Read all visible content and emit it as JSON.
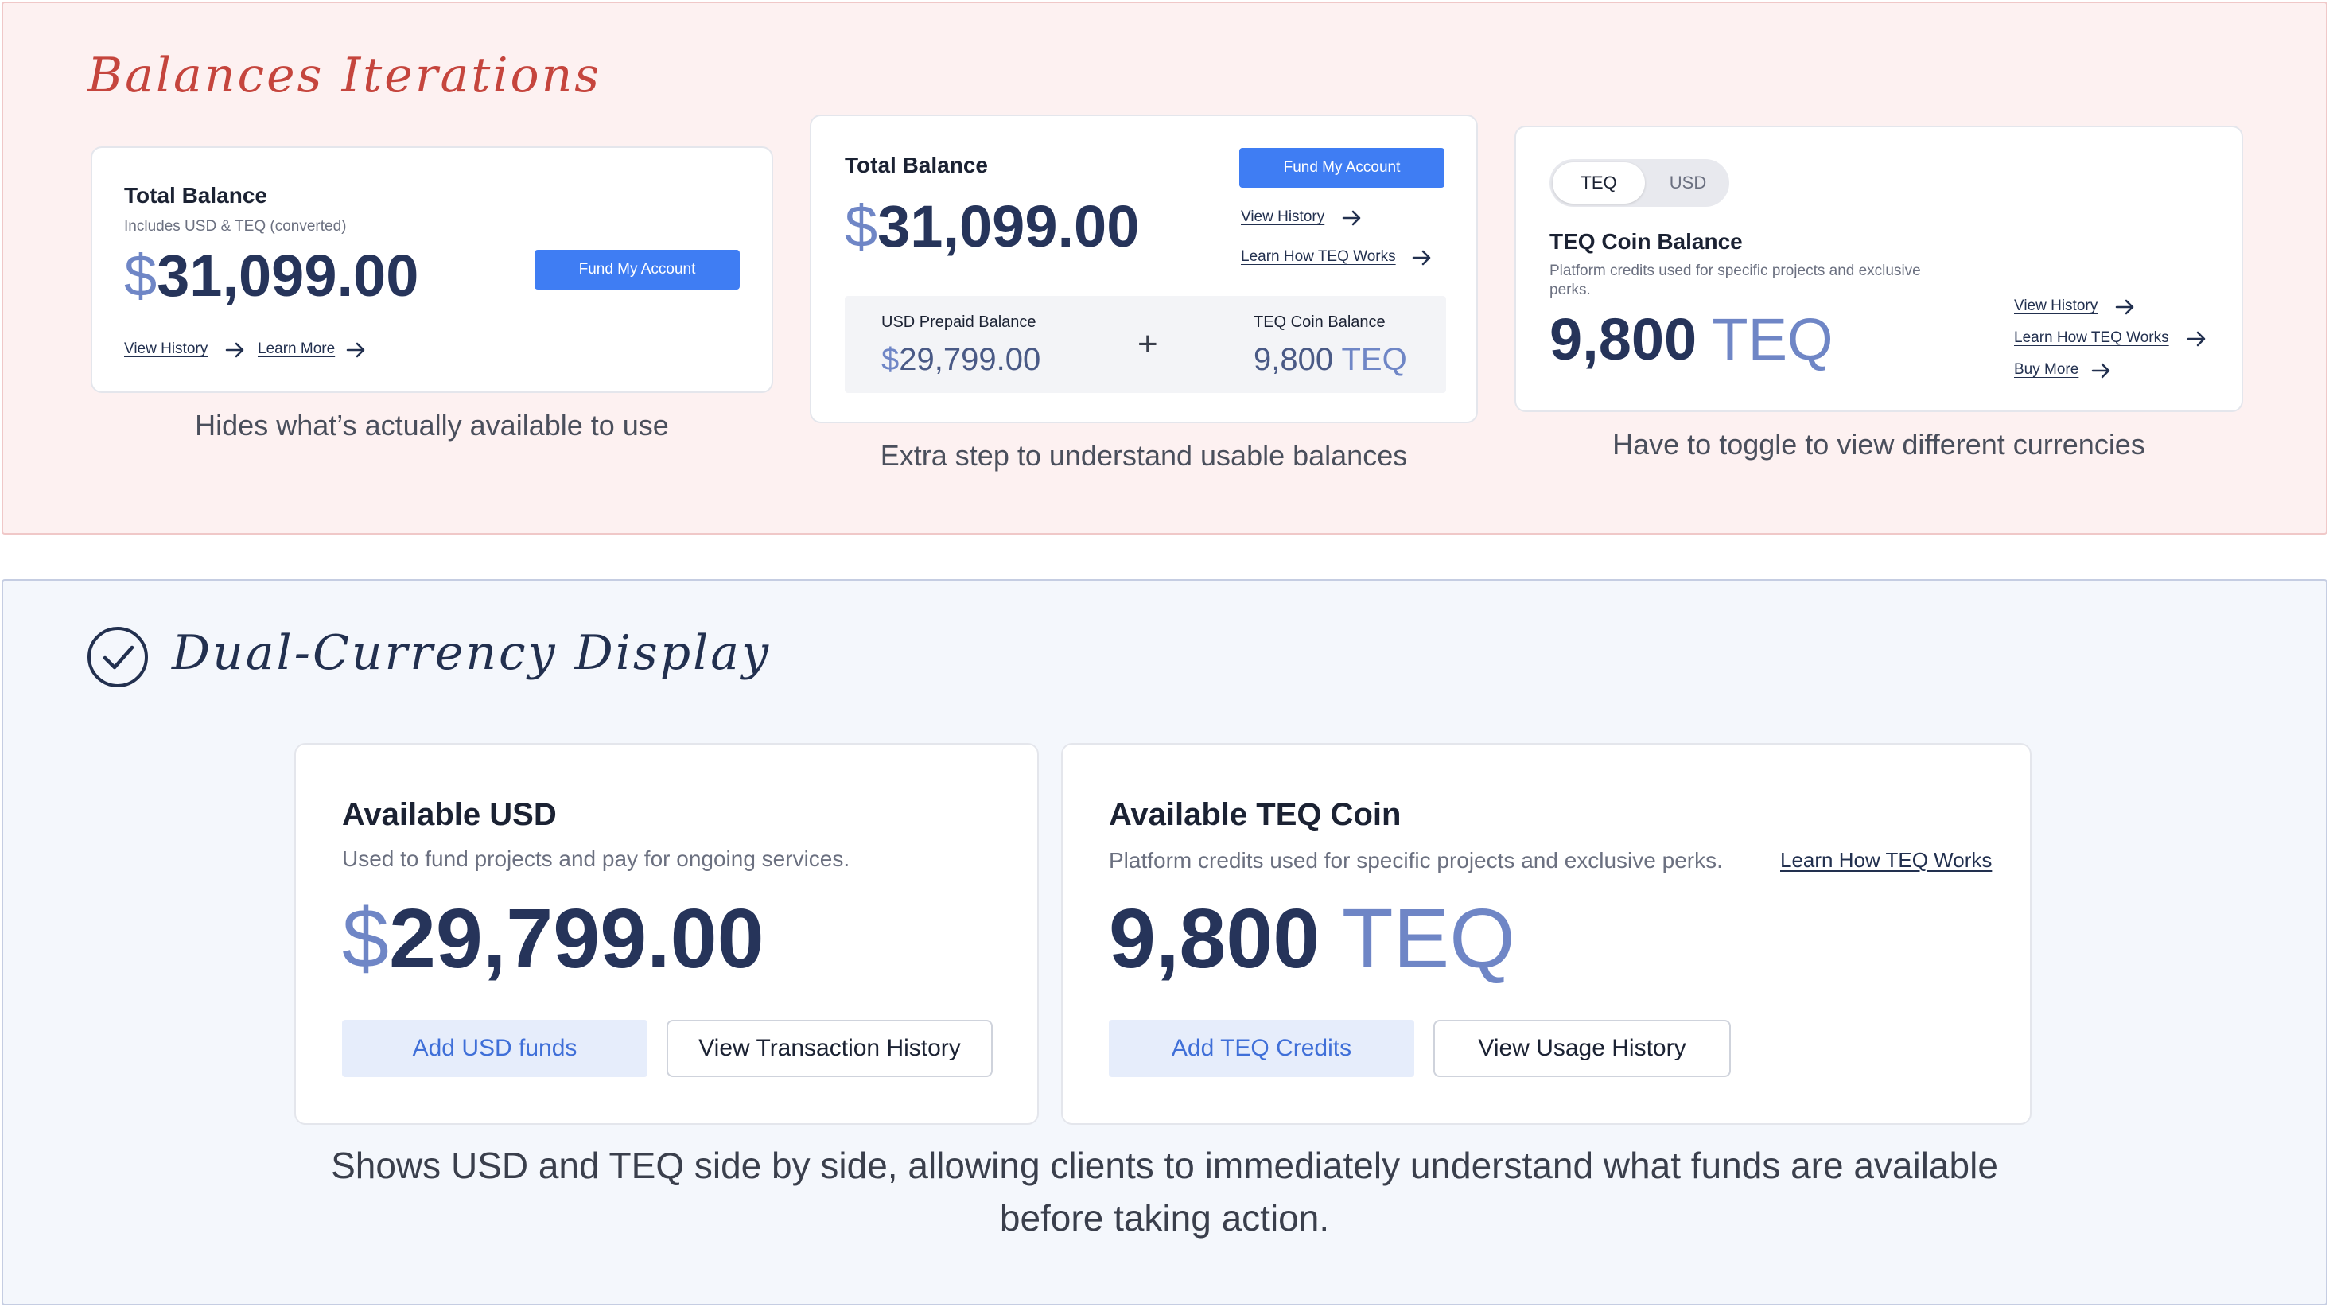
{
  "iterations": {
    "title": "Balances Iterations",
    "v1": {
      "card_title": "Total Balance",
      "card_subtitle": "Includes USD & TEQ (converted)",
      "currency_symbol": "$",
      "amount": "31,099.00",
      "fund_button": "Fund My Account",
      "link_history": "View History",
      "link_learn": "Learn More",
      "caption": "Hides what’s actually available to use"
    },
    "v2": {
      "card_title": "Total Balance",
      "currency_symbol": "$",
      "amount": "31,099.00",
      "fund_button": "Fund My Account",
      "link_history": "View History",
      "link_learn": "Learn How TEQ Works",
      "usd_label": "USD Prepaid Balance",
      "usd_symbol": "$",
      "usd_amount": "29,799.00",
      "plus": "+",
      "teq_label": "TEQ Coin Balance",
      "teq_amount": "9,800",
      "teq_unit": "TEQ",
      "caption": "Extra step to understand usable balances"
    },
    "v3": {
      "toggle_active": "TEQ",
      "toggle_inactive": "USD",
      "card_title": "TEQ Coin Balance",
      "card_desc_line1": "Platform credits used for specific projects and exclusive",
      "card_desc_line2": "perks.",
      "amount": "9,800",
      "unit": "TEQ",
      "link_history": "View History",
      "link_learn": "Learn How TEQ Works",
      "link_buy": "Buy More",
      "caption": "Have to toggle to view different currencies"
    }
  },
  "final": {
    "title": "Dual-Currency Display",
    "usd_card": {
      "title": "Available USD",
      "desc": "Used to fund projects and pay for ongoing services.",
      "symbol": "$",
      "amount": "29,799.00",
      "primary_button": "Add USD funds",
      "secondary_button": "View Transaction History"
    },
    "teq_card": {
      "title": "Available TEQ Coin",
      "desc": "Platform credits used for specific projects and exclusive perks.",
      "link": "Learn How TEQ Works",
      "amount": "9,800",
      "unit": "TEQ",
      "primary_button": "Add TEQ Credits",
      "secondary_button": "View Usage History"
    },
    "caption_line1": "Shows USD and TEQ side by side, allowing clients to immediately understand what funds are available",
    "caption_line2": "before taking action."
  },
  "colors": {
    "top_panel_bg": "#fdf1f1",
    "top_title": "#c5453d",
    "bottom_panel_bg": "#f4f7fc",
    "primary_button": "#3f7df3",
    "soft_button_bg": "#e6edfb",
    "amount_dark": "#26345a",
    "amount_light": "#6f86c6"
  },
  "icons": [
    "arrow-right-icon",
    "check-circle-icon",
    "plus-icon"
  ]
}
